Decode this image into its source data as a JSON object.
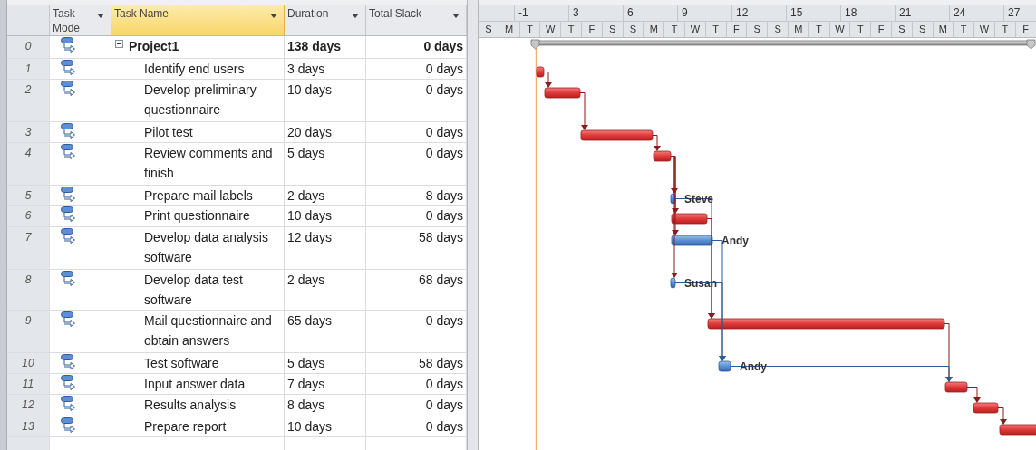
{
  "columns": [
    {
      "label": "Task Mode",
      "selected": false
    },
    {
      "label": "Task Name",
      "selected": true
    },
    {
      "label": "Duration",
      "selected": false
    },
    {
      "label": "Total Slack",
      "selected": false
    }
  ],
  "timescale": {
    "major": [
      "-1",
      "3",
      "6",
      "9",
      "12",
      "15",
      "18",
      "21",
      "24",
      "27"
    ],
    "minor": [
      "S",
      "M",
      "T",
      "W",
      "T",
      "F",
      "S",
      "S",
      "M",
      "T",
      "W",
      "T",
      "F",
      "S",
      "S",
      "M",
      "T",
      "W",
      "T",
      "F",
      "S",
      "S",
      "M",
      "T",
      "W",
      "T",
      "F"
    ]
  },
  "tasks": [
    {
      "id": "0",
      "name": "Project1",
      "duration": "138 days",
      "total_slack": "0 days",
      "kind": "summary",
      "expanded": true
    },
    {
      "id": "1",
      "name": "Identify end users",
      "duration": "3 days",
      "total_slack": "0 days",
      "kind": "task",
      "critical": true
    },
    {
      "id": "2",
      "name": "Develop preliminary questionnaire",
      "duration": "10 days",
      "total_slack": "0 days",
      "kind": "task",
      "critical": true
    },
    {
      "id": "3",
      "name": "Pilot test",
      "duration": "20 days",
      "total_slack": "0 days",
      "kind": "task",
      "critical": true
    },
    {
      "id": "4",
      "name": "Review comments and finish",
      "duration": "5 days",
      "total_slack": "0 days",
      "kind": "task",
      "critical": true
    },
    {
      "id": "5",
      "name": "Prepare mail labels",
      "duration": "2 days",
      "total_slack": "8 days",
      "kind": "task",
      "critical": false,
      "resource": "Steve"
    },
    {
      "id": "6",
      "name": "Print questionnaire",
      "duration": "10 days",
      "total_slack": "0 days",
      "kind": "task",
      "critical": true
    },
    {
      "id": "7",
      "name": "Develop data analysis software",
      "duration": "12 days",
      "total_slack": "58 days",
      "kind": "task",
      "critical": false,
      "resource": "Andy"
    },
    {
      "id": "8",
      "name": "Develop data test software",
      "duration": "2 days",
      "total_slack": "68 days",
      "kind": "task",
      "critical": false,
      "resource": "Susan"
    },
    {
      "id": "9",
      "name": "Mail questionnaire and obtain answers",
      "duration": "65 days",
      "total_slack": "0 days",
      "kind": "task",
      "critical": true
    },
    {
      "id": "10",
      "name": "Test software",
      "duration": "5 days",
      "total_slack": "58 days",
      "kind": "task",
      "critical": false,
      "resource": "Andy"
    },
    {
      "id": "11",
      "name": "Input answer data",
      "duration": "7 days",
      "total_slack": "0 days",
      "kind": "task",
      "critical": true
    },
    {
      "id": "12",
      "name": "Results analysis",
      "duration": "8 days",
      "total_slack": "0 days",
      "kind": "task",
      "critical": true
    },
    {
      "id": "13",
      "name": "Prepare report",
      "duration": "10 days",
      "total_slack": "0 days",
      "kind": "task",
      "critical": true
    }
  ]
}
